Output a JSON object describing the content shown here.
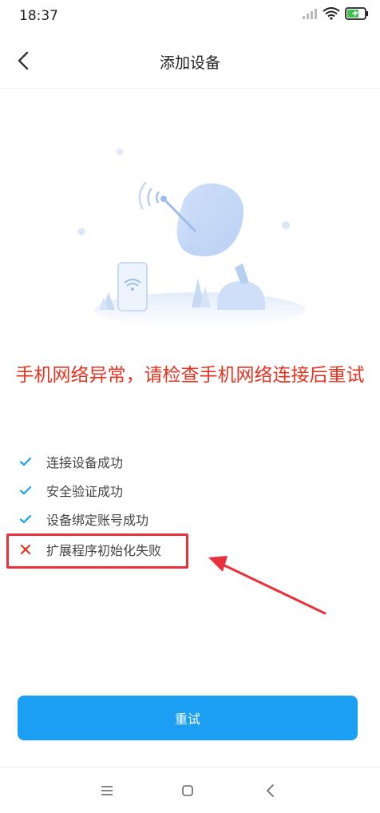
{
  "status_bar": {
    "time": "18:37",
    "icons": [
      "signal-icon",
      "wifi-icon",
      "battery-charging-icon"
    ]
  },
  "header": {
    "title": "添加设备",
    "back_icon": "chevron-left-icon"
  },
  "error_message": "手机网络异常，请检查手机网络连接后重试",
  "steps": [
    {
      "label": "连接设备成功",
      "status": "success",
      "icon": "check-icon"
    },
    {
      "label": "安全验证成功",
      "status": "success",
      "icon": "check-icon"
    },
    {
      "label": "设备绑定账号成功",
      "status": "success",
      "icon": "check-icon"
    },
    {
      "label": "扩展程序初始化失败",
      "status": "failed",
      "icon": "cross-icon"
    }
  ],
  "retry_button": {
    "label": "重试"
  },
  "system_nav": [
    "menu-icon",
    "home-icon",
    "back-icon"
  ],
  "colors": {
    "accent": "#1a9ff2",
    "error": "#e53321",
    "check": "#1a9ff2",
    "annotation": "#e8313a"
  }
}
